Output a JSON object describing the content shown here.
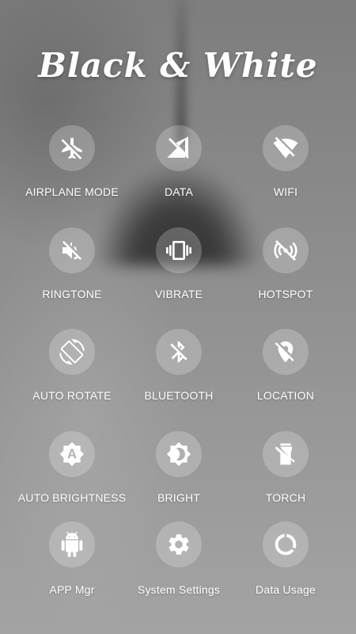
{
  "title": "Black & White",
  "tiles": [
    {
      "label": "AIRPLANE MODE",
      "icon": "airplane-off-icon"
    },
    {
      "label": "DATA",
      "icon": "mobile-data-off-icon"
    },
    {
      "label": "WIFI",
      "icon": "wifi-off-icon"
    },
    {
      "label": "RINGTONE",
      "icon": "volume-off-icon"
    },
    {
      "label": "VIBRATE",
      "icon": "vibrate-icon"
    },
    {
      "label": "HOTSPOT",
      "icon": "hotspot-off-icon"
    },
    {
      "label": "AUTO ROTATE",
      "icon": "screen-rotation-icon"
    },
    {
      "label": "BLUETOOTH",
      "icon": "bluetooth-off-icon"
    },
    {
      "label": "LOCATION",
      "icon": "location-off-icon"
    },
    {
      "label": "AUTO BRIGHTNESS",
      "icon": "auto-brightness-icon"
    },
    {
      "label": "BRIGHT",
      "icon": "brightness-icon"
    },
    {
      "label": "TORCH",
      "icon": "flashlight-off-icon"
    },
    {
      "label": "APP Mgr",
      "icon": "android-icon"
    },
    {
      "label": "System Settings",
      "icon": "gear-icon"
    },
    {
      "label": "Data Usage",
      "icon": "data-usage-icon"
    }
  ]
}
